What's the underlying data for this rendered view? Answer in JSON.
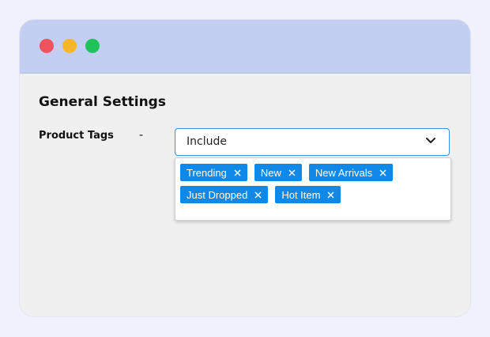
{
  "section": {
    "title": "General Settings"
  },
  "field": {
    "label": "Product Tags",
    "separator": "-",
    "select_value": "Include"
  },
  "tags": [
    "Trending",
    "New",
    "New Arrivals",
    "Just Dropped",
    "Hot Item"
  ],
  "icons": {
    "chevron": "chevron-down-icon",
    "remove": "close-icon"
  },
  "colors": {
    "titlebar": "#c2cff3",
    "tag_background": "#1088e8",
    "select_border": "#3b8ee0",
    "traffic_red": "#f0525e",
    "traffic_yellow": "#f8b62b",
    "traffic_green": "#1fc35a"
  }
}
